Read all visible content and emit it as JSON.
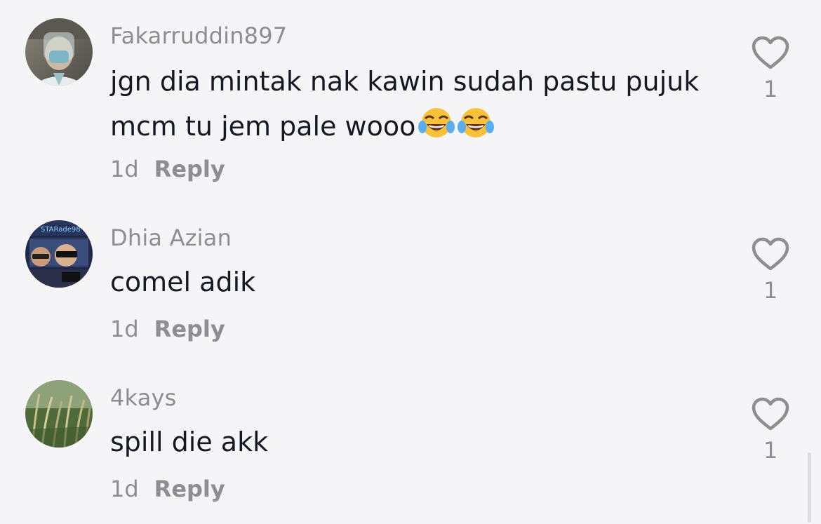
{
  "comments": [
    {
      "username": "Fakarruddin897",
      "text_line1": "jgn dia mintak nak kawin sudah pastu pujuk",
      "text_line2": "mcm tu jem pale wooo",
      "emoji": [
        "face-with-tears-of-joy",
        "face-with-tears-of-joy"
      ],
      "time": "1d",
      "reply_label": "Reply",
      "like_count": "1",
      "avatar": "person-in-face-shield-photo"
    },
    {
      "username": "Dhia Azian",
      "text": "comel adik",
      "time": "1d",
      "reply_label": "Reply",
      "like_count": "1",
      "avatar": "cartoon-avatar-image",
      "avatar_text": "STARade98"
    },
    {
      "username": "4kays",
      "text": "spill die akk",
      "time": "1d",
      "reply_label": "Reply",
      "like_count": "1",
      "avatar": "rice-plant-photo"
    }
  ],
  "colors": {
    "background": "#f5f4f6",
    "username": "#8e8d92",
    "text": "#161823"
  }
}
